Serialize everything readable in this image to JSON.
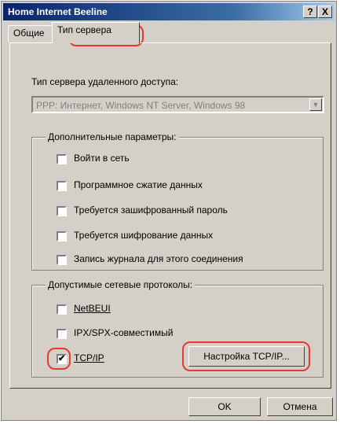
{
  "window": {
    "title": "Home Internet Beeline",
    "help_button": "?",
    "close_button": "X"
  },
  "tabs": [
    {
      "label": "Общие"
    },
    {
      "label": "Тип сервера"
    }
  ],
  "server_type": {
    "label": "Тип сервера удаленного доступа:",
    "value": "PPP: Интернет, Windows NT Server, Windows 98"
  },
  "advanced": {
    "legend": "Дополнительные параметры:",
    "options": [
      {
        "label": "Войти в сеть",
        "checked": false
      },
      {
        "label": "Программное сжатие данных",
        "checked": false
      },
      {
        "label": "Требуется зашифрованный пароль",
        "checked": false
      },
      {
        "label": "Требуется шифрование данных",
        "checked": false
      },
      {
        "label": "Запись журнала для этого соединения",
        "checked": false
      }
    ]
  },
  "protocols": {
    "legend": "Допустимые сетевые протоколы:",
    "options": [
      {
        "label": "NetBEUI",
        "checked": false
      },
      {
        "label": "IPX/SPX-совместимый",
        "checked": false
      },
      {
        "label": "TCP/IP",
        "checked": true
      }
    ],
    "tcpip_settings_button": "Настройка TCP/IP..."
  },
  "footer": {
    "ok_button": "OK",
    "cancel_button": "Отмена"
  },
  "colors": {
    "highlight_ring": "#e53935",
    "title_bar": "#0a246a",
    "dialog_face": "#d4d0c8"
  }
}
